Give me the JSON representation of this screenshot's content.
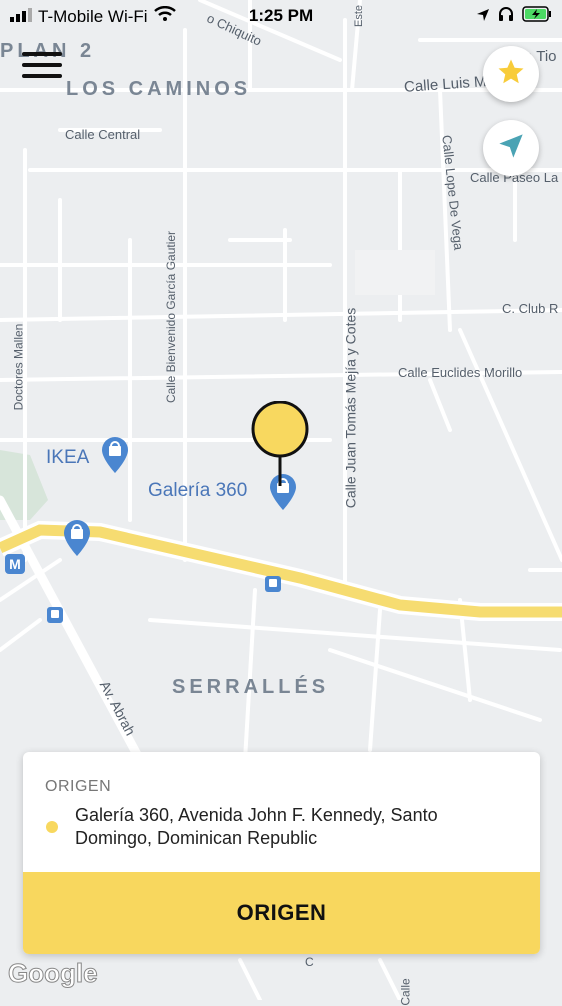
{
  "status_bar": {
    "carrier": "T-Mobile Wi-Fi",
    "time": "1:25 PM"
  },
  "map": {
    "area_labels": [
      "PLAN 2",
      "LOS CAMINOS",
      "SERRALLÉS"
    ],
    "streets": [
      "o Chiquito",
      "Calle Luis M",
      "a Tio",
      "Calle Central",
      "Calle Lope De Vega",
      "Calle Paseo La",
      "C. Club R",
      "Calle Euclides Morillo",
      "Calle Bienvenido García Gautier",
      "Calle Juan Tomás Mejía y Cotes",
      "Doctores Mallen",
      "Av. Abrah",
      "Este",
      "Calle",
      "C"
    ],
    "pois": [
      "IKEA",
      "Galería 360"
    ],
    "metro_icon": "M",
    "attribution": "Google"
  },
  "buttons": {
    "menu_icon": "hamburger-icon",
    "favorites_icon": "star-icon",
    "location_icon": "navigation-arrow-icon"
  },
  "colors": {
    "accent": "#f8d75e",
    "route": "#f6dc71",
    "poi": "#4a86d0"
  },
  "card": {
    "section_label": "ORIGEN",
    "address": "Galería 360, Avenida John F. Kennedy, Santo Domingo, Dominican Republic",
    "button_label": "ORIGEN"
  }
}
